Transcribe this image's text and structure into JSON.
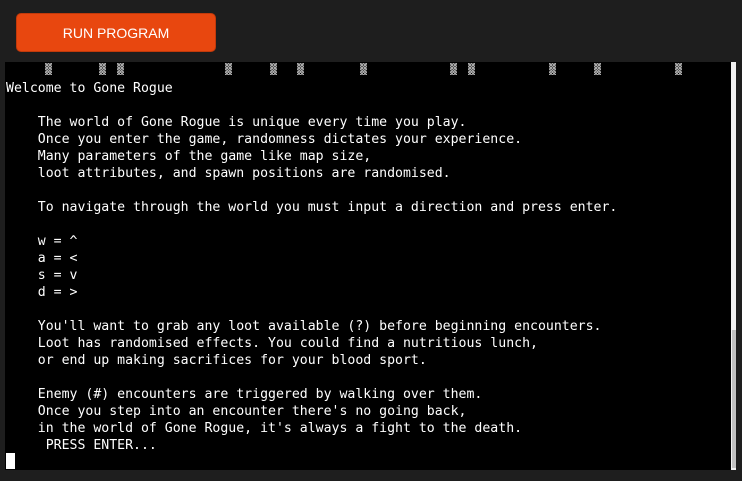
{
  "toolbar": {
    "run_label": "RUN PROGRAM",
    "run_color": "#e8470f"
  },
  "terminal": {
    "background": "#000000",
    "foreground": "#ffffff",
    "shade_glyph": "▒",
    "text": "Welcome to Gone Rogue\n\n    The world of Gone Rogue is unique every time you play.\n    Once you enter the game, randomness dictates your experience.\n    Many parameters of the game like map size,\n    loot attributes, and spawn positions are randomised.\n\n    To navigate through the world you must input a direction and press enter.\n\n    w = ^\n    a = <\n    s = v\n    d = >\n\n    You'll want to grab any loot available (?) before beginning encounters.\n    Loot has randomised effects. You could find a nutritious lunch,\n    or end up making sacrifices for your blood sport.\n\n    Enemy (#) encounters are triggered by walking over them.\n    Once you step into an encounter there's no going back,\n    in the world of Gone Rogue, it's always a fight to the death.\n     PRESS ENTER..."
  }
}
